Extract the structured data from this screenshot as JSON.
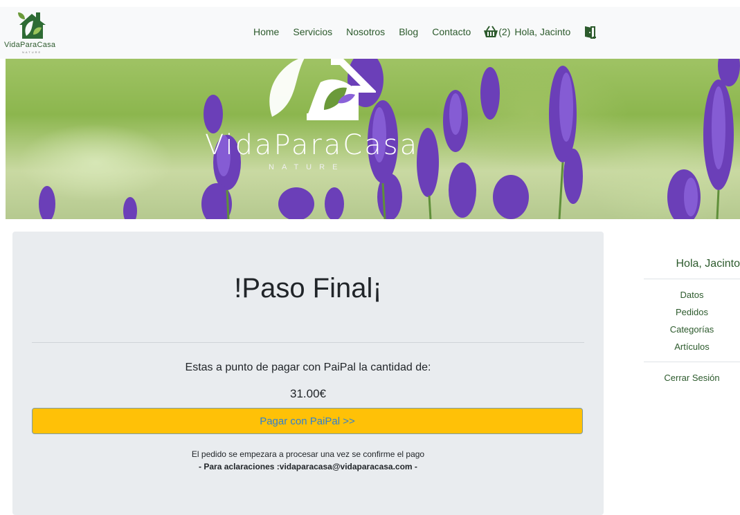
{
  "brand": {
    "name": "VidaParaCasa",
    "sub": "NATURE"
  },
  "nav": {
    "links": [
      "Home",
      "Servicios",
      "Nosotros",
      "Blog",
      "Contacto"
    ],
    "cart_count": "(2)",
    "greeting": "Hola,  Jacinto"
  },
  "hero": {
    "title": "VidaParaCasa",
    "subtitle": "NATURE"
  },
  "card": {
    "title": "!Paso Final¡",
    "text": "Estas a punto de pagar con PaiPal la cantidad de:",
    "amount": "31.00€",
    "pay_button": "Pagar con PaiPal >>",
    "note_line1": "El pedido se empezara a procesar una vez se confirme el pago",
    "note_line2": "- Para aclaraciones :vidaparacasa@vidaparacasa.com -"
  },
  "sidebar": {
    "hello": "Hola, Jacinto",
    "items": [
      "Datos",
      "Pedidos",
      "Categorías",
      "Artículos"
    ],
    "logout": "Cerrar Sesión"
  },
  "colors": {
    "accent_green": "#2c5a2c",
    "pay_button": "#ffc107",
    "pay_text": "#2f7fd1",
    "card_bg": "#e9ecef"
  },
  "icons": [
    "house-leaf-logo-icon",
    "basket-icon",
    "door-exit-icon"
  ]
}
